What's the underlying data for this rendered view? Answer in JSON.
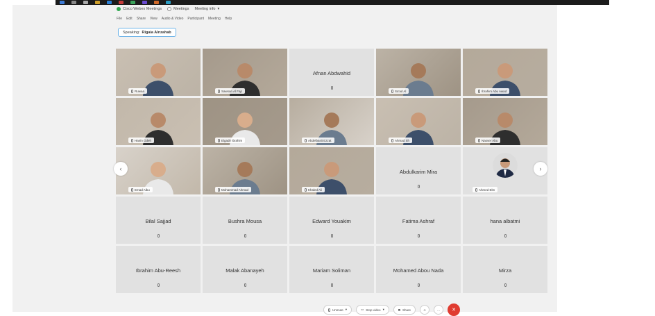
{
  "window": {
    "title_items": [
      "Cisco Webex Meetings",
      "Meetings",
      "Meeting info"
    ],
    "menu": [
      "File",
      "Edit",
      "Share",
      "View",
      "Audio & Video",
      "Participant",
      "Meeting",
      "Help"
    ],
    "speaking_label": "Speaking:",
    "speaking_name": "Rigaia Alnzahab"
  },
  "participants": [
    {
      "name": "Ruwaa",
      "kind": "video"
    },
    {
      "name": "Sawsan Al Fajr",
      "kind": "video"
    },
    {
      "name": "Afnan Abdwahid",
      "kind": "text"
    },
    {
      "name": "Sa'ad Al",
      "kind": "video"
    },
    {
      "name": "Ibrahim Abu Awad",
      "kind": "video"
    },
    {
      "name": "Hanin Odeh",
      "kind": "video"
    },
    {
      "name": "Elgadir Ibrahim",
      "kind": "video"
    },
    {
      "name": "Abdelbasit Ezzat",
      "kind": "video"
    },
    {
      "name": "Ahmad Sh",
      "kind": "video"
    },
    {
      "name": "Nasser Abu",
      "kind": "video"
    },
    {
      "name": "Emad Albu",
      "kind": "video"
    },
    {
      "name": "Mohammad Ahmad",
      "kind": "video"
    },
    {
      "name": "Khaled Ali",
      "kind": "video"
    },
    {
      "name": "Abdulkarim Mira",
      "kind": "text"
    },
    {
      "name": "Ahmed Elm",
      "kind": "avatar"
    },
    {
      "name": "Bilal Sajjad",
      "kind": "text"
    },
    {
      "name": "Bushra Mousa",
      "kind": "text"
    },
    {
      "name": "Edward Youakim",
      "kind": "text"
    },
    {
      "name": "Fatima Ashraf",
      "kind": "text"
    },
    {
      "name": "hana albatmi",
      "kind": "text"
    },
    {
      "name": "Ibrahim Abu-Reesh",
      "kind": "text"
    },
    {
      "name": "Malak Abanayeh",
      "kind": "text"
    },
    {
      "name": "Mariam Soliman",
      "kind": "text"
    },
    {
      "name": "Mohamed Abou Nada",
      "kind": "text"
    },
    {
      "name": "Mirza",
      "kind": "text"
    }
  ],
  "controls": {
    "unmute": "Unmute",
    "start_video": "Stop video",
    "share": "Share"
  },
  "colors": {
    "active_outline": "#4fa9d9",
    "end_button": "#e03c31",
    "tile_empty": "#e1e1e1"
  },
  "icons": {
    "prev": "chevron-left-icon",
    "next": "chevron-right-icon",
    "mic": "mic-icon",
    "end": "hangup-icon"
  }
}
